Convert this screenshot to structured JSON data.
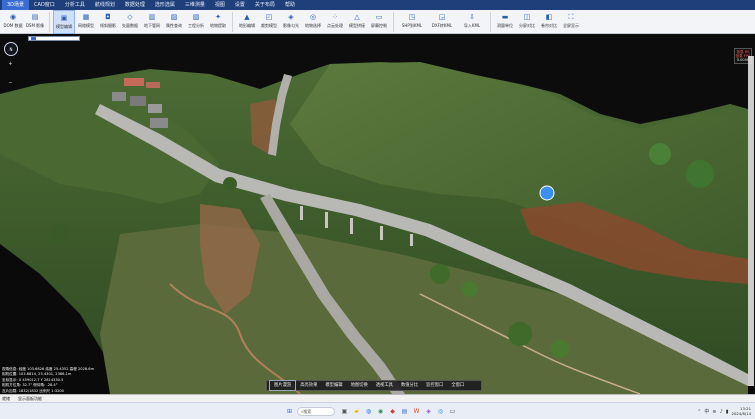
{
  "menubar": {
    "items": [
      "3D场景",
      "CAD窗口",
      "分析工具",
      "航线规划",
      "数据处理",
      "选形选属",
      "三维测量",
      "视图",
      "设置",
      "关于布局",
      "帮助"
    ],
    "active_index": 0
  },
  "ribbon": {
    "group1": [
      {
        "label": "DOM\n数据",
        "icon": "globe-icon"
      },
      {
        "label": "DSM\n影像",
        "icon": "layers-icon"
      },
      {
        "label": "模型编辑",
        "icon": "cube-icon"
      },
      {
        "label": "网络模型",
        "icon": "mesh-icon"
      },
      {
        "label": "倾斜摄影",
        "icon": "camera-icon"
      },
      {
        "label": "矢量数据",
        "icon": "vector-icon"
      },
      {
        "label": "地下管网",
        "icon": "pipe-icon"
      },
      {
        "label": "属性查询",
        "icon": "query-icon"
      },
      {
        "label": "工程分析",
        "icon": "chart-icon"
      },
      {
        "label": "地物提取",
        "icon": "extract-icon"
      }
    ],
    "group2": [
      {
        "label": "地形编辑",
        "icon": "terrain-icon"
      },
      {
        "label": "裁剪模型",
        "icon": "clip-icon"
      },
      {
        "label": "影像匀光",
        "icon": "image-icon"
      },
      {
        "label": "地物选择",
        "icon": "select-icon"
      },
      {
        "label": "点云处理",
        "icon": "points-icon"
      },
      {
        "label": "模型拼接",
        "icon": "merge-icon"
      },
      {
        "label": "屏幕控制",
        "icon": "screen-icon"
      }
    ],
    "group3": [
      {
        "label": "SHP到KML",
        "icon": "shp-icon"
      },
      {
        "label": "DXF转KML",
        "icon": "dxf-icon"
      },
      {
        "label": "导入KML",
        "icon": "import-icon"
      }
    ],
    "group4": [
      {
        "label": "测量单位",
        "icon": "ruler-icon"
      },
      {
        "label": "分屏对比",
        "icon": "split-icon"
      },
      {
        "label": "卷帘对比",
        "icon": "swipe-icon"
      },
      {
        "label": "全屏显示",
        "icon": "fullscreen-icon"
      }
    ]
  },
  "viewport": {
    "compass_label": "N",
    "zoom_plus": "+",
    "zoom_minus": "−",
    "right_panel": [
      "信息 RS",
      "信息 FPS",
      "0.0000"
    ],
    "marker_color": "#3b8ff2"
  },
  "info_lines": [
    "视角信息: 经度 103.6826  纬度 25.4352  高程 2028.6m",
    "相机位置: 103.6814, 25.4301, 2386.1m",
    "坐标显示: X 459012.7  Y 2814330.5",
    "相机方位角: 32.7°  俯仰角: -28.4°",
    "瓦片加载: 1832/1832  比例尺 1:3200"
  ],
  "bottom_tools": [
    "图片漫游",
    "高亮效果",
    "模型编辑",
    "地图切换",
    "透视工具",
    "数值分比",
    "监控窗口",
    "全窗口"
  ],
  "bottom_tools_active": 0,
  "statusbar": {
    "left": "就绪",
    "middle": "显示面板功能"
  },
  "taskbar": {
    "search_placeholder": "搜索",
    "time": "13:21",
    "date": "2024/8/14",
    "lang": "中",
    "tray_icons": [
      "wifi-icon",
      "volume-icon",
      "battery-icon"
    ]
  }
}
